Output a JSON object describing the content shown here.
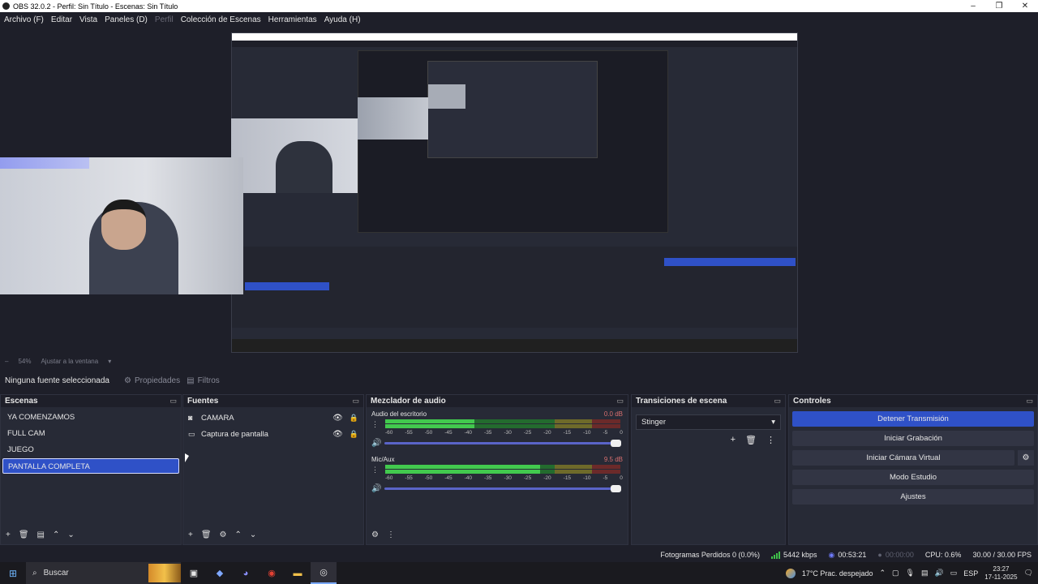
{
  "window": {
    "title": "OBS 32.0.2 - Perfil: Sin Título - Escenas: Sin Título",
    "minimize": "–",
    "maximize": "❐",
    "close": "✕"
  },
  "menu": [
    "Archivo (F)",
    "Editar",
    "Vista",
    "Paneles (D)",
    "Perfil",
    "Colección de Escenas",
    "Herramientas",
    "Ayuda (H)"
  ],
  "preview_bar": {
    "zoom": "54%",
    "fit": "Ajustar a la ventana"
  },
  "props_bar": {
    "no_source": "Ninguna fuente seleccionada",
    "properties": "Propiedades",
    "filters": "Filtros"
  },
  "scenes": {
    "title": "Escenas",
    "items": [
      "YA COMENZAMOS",
      "FULL CAM",
      "JUEGO",
      "PANTALLA COMPLETA"
    ],
    "selected_index": 3
  },
  "sources": {
    "title": "Fuentes",
    "items": [
      {
        "name": "CAMARA",
        "icon": "camera-icon"
      },
      {
        "name": "Captura de pantalla",
        "icon": "monitor-icon"
      }
    ]
  },
  "mixer": {
    "title": "Mezclador de audio",
    "channels": [
      {
        "name": "Audio del escritorio",
        "db": "0.0 dB",
        "level": 0.38
      },
      {
        "name": "Mic/Aux",
        "db": "9.5 dB",
        "level": 0.66
      }
    ],
    "scale": [
      "-60",
      "-55",
      "-50",
      "-45",
      "-40",
      "-35",
      "-30",
      "-25",
      "-20",
      "-15",
      "-10",
      "-5",
      "0"
    ]
  },
  "transitions": {
    "title": "Transiciones de escena",
    "selected": "Stinger"
  },
  "controls": {
    "title": "Controles",
    "stop_stream": "Detener Transmisión",
    "start_record": "Iniciar Grabación",
    "virtual_cam": "Iniciar Cámara Virtual",
    "studio_mode": "Modo Estudio",
    "settings": "Ajustes"
  },
  "status": {
    "dropped": "Fotogramas Perdidos 0 (0.0%)",
    "bitrate": "5442 kbps",
    "stream_time": "00:53:21",
    "rec_time": "00:00:00",
    "cpu": "CPU: 0.6%",
    "fps": "30.00 / 30.00 FPS"
  },
  "taskbar": {
    "search": "Buscar",
    "weather": "17°C  Prac. despejado",
    "lang": "ESP",
    "time": "23:27",
    "date": "17-11-2025"
  },
  "colors": {
    "accent": "#2f51c7",
    "bg": "#1e1f29",
    "panel": "#272a36"
  }
}
